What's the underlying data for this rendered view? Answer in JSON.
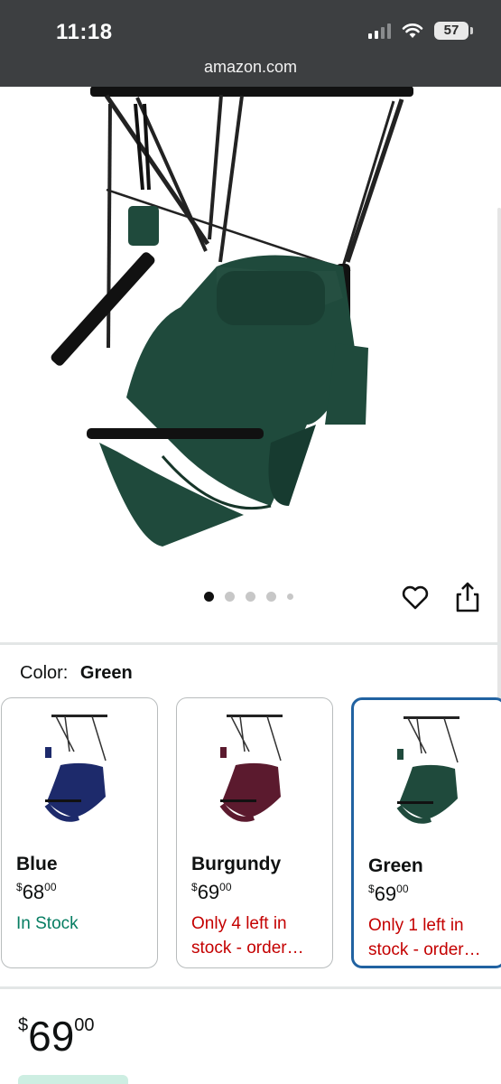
{
  "status_bar": {
    "time": "11:18",
    "battery": "57"
  },
  "browser": {
    "url": "amazon.com"
  },
  "gallery": {
    "image_count": 5,
    "active_index": 0
  },
  "color_selector": {
    "label": "Color:",
    "selected": "Green"
  },
  "variants": [
    {
      "name": "Blue",
      "currency": "$",
      "whole": "68",
      "cents": "00",
      "stock": "In Stock",
      "stock_status": "in",
      "chair_color": "#1d2a6b"
    },
    {
      "name": "Burgundy",
      "currency": "$",
      "whole": "69",
      "cents": "00",
      "stock": "Only 4 left in stock - order…",
      "stock_status": "low",
      "chair_color": "#5b1a2e"
    },
    {
      "name": "Green",
      "currency": "$",
      "whole": "69",
      "cents": "00",
      "stock": "Only 1 left in stock - order…",
      "stock_status": "low",
      "chair_color": "#1f4a3c"
    }
  ],
  "price": {
    "currency": "$",
    "whole": "69",
    "cents": "00"
  },
  "colors": {
    "accent_selected": "#2162a1",
    "in_stock": "#067d62",
    "low_stock": "#c40000",
    "product_green": "#1f4a3c"
  }
}
